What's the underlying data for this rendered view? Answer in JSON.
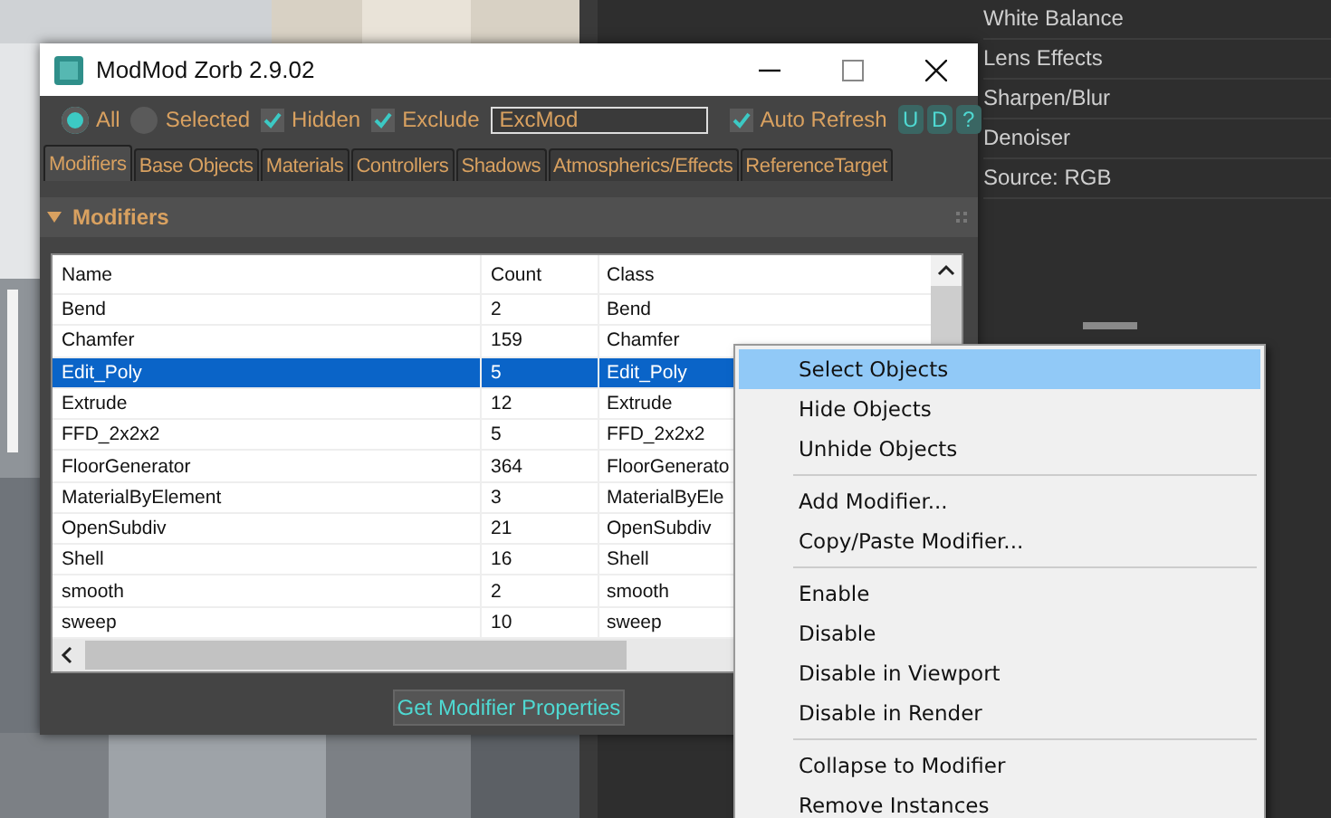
{
  "side_panel": {
    "items": [
      "White Balance",
      "Lens Effects",
      "Sharpen/Blur",
      "Denoiser",
      "Source: RGB"
    ]
  },
  "window": {
    "title": "ModMod Zorb 2.9.02",
    "controls": [
      {
        "kind": "radio",
        "label": "All",
        "selected": true
      },
      {
        "kind": "radio",
        "label": "Selected",
        "selected": false
      },
      {
        "kind": "checkbox",
        "label": "Hidden",
        "checked": true
      },
      {
        "kind": "checkbox",
        "label": "Exclude",
        "checked": true
      },
      {
        "kind": "field",
        "value": "ExcMod"
      },
      {
        "kind": "checkbox",
        "label": "Auto Refresh",
        "checked": true
      }
    ],
    "small_buttons": [
      "U",
      "D",
      "?"
    ],
    "tabs": [
      {
        "label": "Modifiers",
        "selected": true
      },
      {
        "label": "Base Objects",
        "selected": false
      },
      {
        "label": "Materials",
        "selected": false
      },
      {
        "label": "Controllers",
        "selected": false
      },
      {
        "label": "Shadows",
        "selected": false
      },
      {
        "label": "Atmospherics/Effects",
        "selected": false
      },
      {
        "label": "ReferenceTarget",
        "selected": false
      }
    ],
    "rollout": {
      "title": "Modifiers",
      "expanded": true
    },
    "table": {
      "columns": [
        "Name",
        "Count",
        "Class"
      ],
      "rows": [
        {
          "cells": [
            "Bend",
            "2",
            "Bend"
          ],
          "selected": false
        },
        {
          "cells": [
            "Chamfer",
            "159",
            "Chamfer"
          ],
          "selected": false
        },
        {
          "cells": [
            "Edit_Poly",
            "5",
            "Edit_Poly"
          ],
          "selected": true
        },
        {
          "cells": [
            "Extrude",
            "12",
            "Extrude"
          ],
          "selected": false
        },
        {
          "cells": [
            "FFD_2x2x2",
            "5",
            "FFD_2x2x2"
          ],
          "selected": false
        },
        {
          "cells": [
            "FloorGenerator",
            "364",
            "FloorGenerato"
          ],
          "selected": false
        },
        {
          "cells": [
            "MaterialByElement",
            "3",
            "MaterialByEle"
          ],
          "selected": false
        },
        {
          "cells": [
            "OpenSubdiv",
            "21",
            "OpenSubdiv"
          ],
          "selected": false
        },
        {
          "cells": [
            "Shell",
            "16",
            "Shell"
          ],
          "selected": false
        },
        {
          "cells": [
            "smooth",
            "2",
            "smooth"
          ],
          "selected": false
        },
        {
          "cells": [
            "sweep",
            "10",
            "sweep"
          ],
          "selected": false
        }
      ]
    },
    "button": "Get Modifier Properties"
  },
  "context_menu": {
    "items": [
      {
        "kind": "item",
        "label": "Select Objects",
        "selected": true
      },
      {
        "kind": "item",
        "label": "Hide Objects",
        "selected": false
      },
      {
        "kind": "item",
        "label": "Unhide Objects",
        "selected": false
      },
      {
        "kind": "separator"
      },
      {
        "kind": "item",
        "label": "Add Modifier...",
        "selected": false
      },
      {
        "kind": "item",
        "label": "Copy/Paste Modifier...",
        "selected": false
      },
      {
        "kind": "separator"
      },
      {
        "kind": "item",
        "label": "Enable",
        "selected": false
      },
      {
        "kind": "item",
        "label": "Disable",
        "selected": false
      },
      {
        "kind": "item",
        "label": "Disable in Viewport",
        "selected": false
      },
      {
        "kind": "item",
        "label": "Disable in Render",
        "selected": false
      },
      {
        "kind": "separator"
      },
      {
        "kind": "item",
        "label": "Collapse to Modifier",
        "selected": false
      },
      {
        "kind": "item",
        "label": "Remove Instances",
        "selected": false
      }
    ]
  }
}
